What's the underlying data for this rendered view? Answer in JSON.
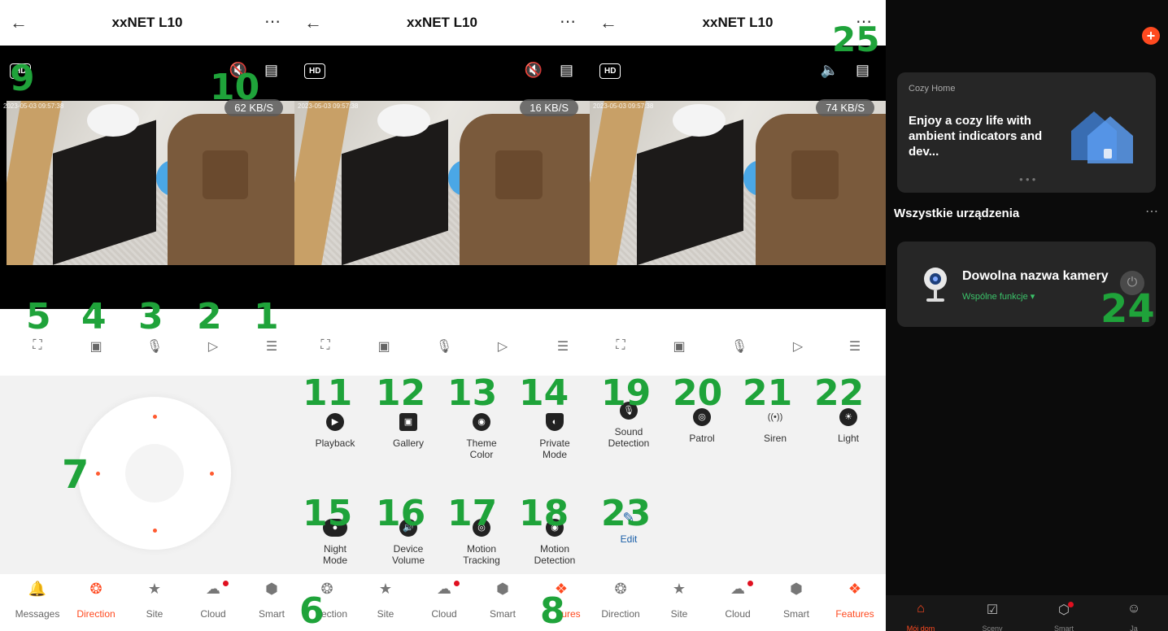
{
  "device": {
    "title": "xxNET L10",
    "back_icon": "arrow-left-icon",
    "more_icon": "more-horizontal-icon",
    "hd_label": "HD",
    "timestamp": "2023-05-03 09:57:38"
  },
  "panels": [
    {
      "speed": "62 KB/S",
      "audio": "muted"
    },
    {
      "speed": "16 KB/S",
      "audio": "muted"
    },
    {
      "speed": "74 KB/S",
      "audio": "on"
    }
  ],
  "control_bar": {
    "icons": [
      "fullscreen-icon",
      "screenshot-icon",
      "microphone-icon",
      "record-icon",
      "menu-icon"
    ]
  },
  "features_page1": [
    {
      "label1": "Playback",
      "label2": "",
      "icon": "play-icon"
    },
    {
      "label1": "Gallery",
      "label2": "",
      "icon": "image-icon"
    },
    {
      "label1": "Theme",
      "label2": "Color",
      "icon": "palette-icon"
    },
    {
      "label1": "Private",
      "label2": "Mode",
      "icon": "shield-icon"
    },
    {
      "label1": "Night",
      "label2": "Mode",
      "icon": "night-toggle-icon"
    },
    {
      "label1": "Device",
      "label2": "Volume",
      "icon": "volume-icon"
    },
    {
      "label1": "Motion",
      "label2": "Tracking",
      "icon": "tracking-icon"
    },
    {
      "label1": "Motion",
      "label2": "Detection",
      "icon": "motion-icon"
    }
  ],
  "features_page2": [
    {
      "label1": "Sound",
      "label2": "Detection",
      "icon": "microphone-icon"
    },
    {
      "label1": "Patrol",
      "label2": "",
      "icon": "patrol-icon"
    },
    {
      "label1": "Siren",
      "label2": "",
      "icon": "siren-icon"
    },
    {
      "label1": "Light",
      "label2": "",
      "icon": "light-icon"
    },
    {
      "label1": "Edit",
      "label2": "",
      "icon": "edit-icon"
    }
  ],
  "tabs": [
    {
      "label": "Messages",
      "icon": "bell-icon"
    },
    {
      "label": "Direction",
      "icon": "direction-icon"
    },
    {
      "label": "Site",
      "icon": "star-icon"
    },
    {
      "label": "Cloud",
      "icon": "cloud-icon"
    },
    {
      "label": "Smart",
      "icon": "smart-icon"
    },
    {
      "label": "Features",
      "icon": "features-icon"
    }
  ],
  "tab_labels_partial": {
    "p2_direction": "ection",
    "p2_features": "ures"
  },
  "annotations": [
    "1",
    "2",
    "3",
    "4",
    "5",
    "6",
    "7",
    "8",
    "9",
    "10",
    "11",
    "12",
    "13",
    "14",
    "15",
    "16",
    "17",
    "18",
    "19",
    "20",
    "21",
    "22",
    "23",
    "24",
    "25"
  ],
  "home": {
    "banner_small": "Cozy Home",
    "banner_text": "Enjoy a cozy life with ambient indicators and dev...",
    "section_title": "Wszystkie urządzenia",
    "device_name": "Dowolna nazwa kamery",
    "device_sub": "Wspólne funkcje",
    "tabs": [
      "Mój dom",
      "Sceny",
      "Smart",
      "Ja"
    ]
  },
  "colors": {
    "accent": "#ff4a20",
    "annotation": "#1fa33a",
    "link": "#1a5fa8",
    "green": "#3bc46a"
  }
}
